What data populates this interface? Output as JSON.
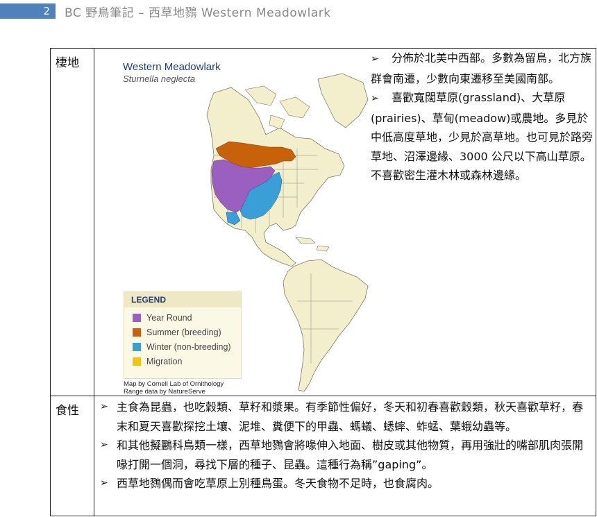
{
  "header": {
    "page_number": "2",
    "title": "BC 野鳥筆記 – 西草地鷚 Western Meadowlark"
  },
  "habitat": {
    "label": "棲地",
    "map": {
      "title": "Western Meadowlark",
      "scientific_name": "Sturnella neglecta",
      "legend_title": "LEGEND",
      "legend": [
        {
          "label": "Year Round",
          "color": "#9b5fc0"
        },
        {
          "label": "Summer (breeding)",
          "color": "#c8620a"
        },
        {
          "label": "Winter (non-breeding)",
          "color": "#3a9fd6"
        },
        {
          "label": "Migration",
          "color": "#f2c416"
        }
      ],
      "credit_line1": "Map by Cornell Lab of Ornithology",
      "credit_line2": "Range data by NatureServe"
    },
    "paragraphs": [
      "分佈於北美中西部。多數為留鳥，北方族群會南遷，少數向東遷移至美國南部。",
      "喜歡寬闊草原(grassland)、大草原(prairies)、草甸(meadow)或農地。多見於中低高度草地，少見於高草地。也可見於路旁草地、沼澤邊緣、3000 公尺以下高山草原。不喜歡密生灌木林或森林邊緣。"
    ]
  },
  "food": {
    "label": "食性",
    "items": [
      "主食為昆蟲，也吃穀類、草籽和漿果。有季節性偏好，冬天和初春喜歡穀類，秋天喜歡草籽，春末和夏天喜歡探挖土壤、泥堆、糞便下的甲蟲、螞蟻、蟋蟀、蚱蜢、葉蛾幼蟲等。",
      "和其他擬鸝科鳥類一樣，西草地鷚會將喙伸入地面、樹皮或其他物質，再用強壯的嘴部肌肉張開喙打開一個洞，尋找下層的種子、昆蟲。這種行為稱”gaping”。",
      "西草地鷚偶而會吃草原上別種鳥蛋。冬天食物不足時，也食腐肉。"
    ]
  },
  "bullet_symbol": "➢"
}
